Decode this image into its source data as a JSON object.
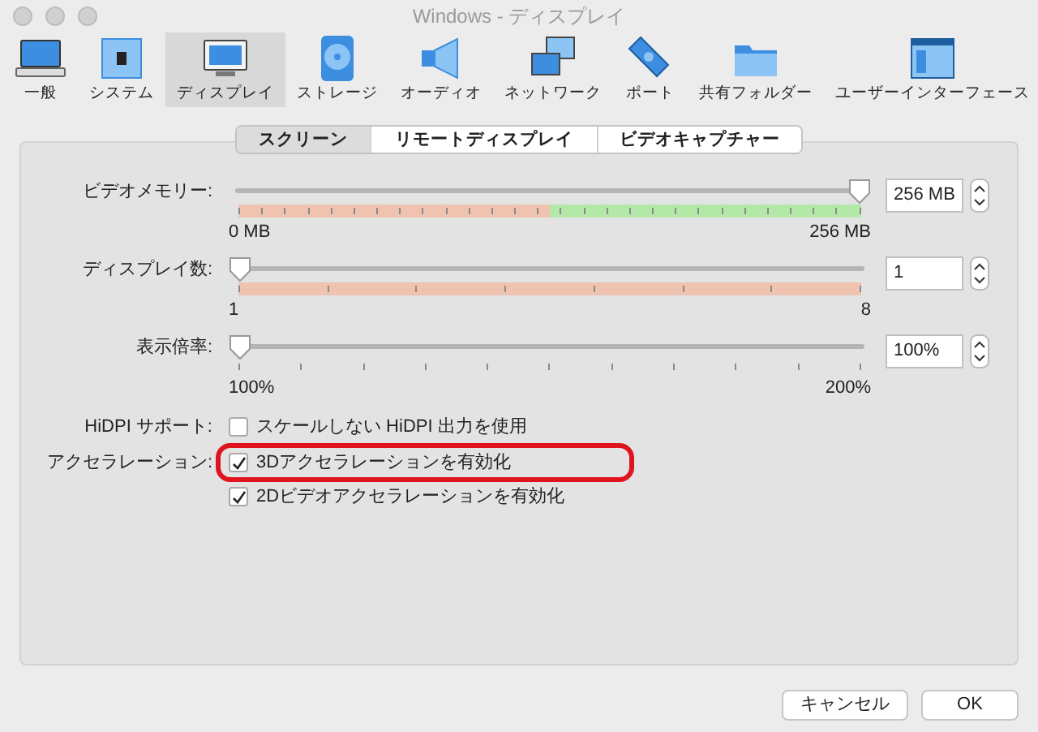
{
  "window": {
    "title": "Windows - ディスプレイ"
  },
  "toolbar": [
    {
      "label": "一般",
      "kind": "general",
      "selected": false
    },
    {
      "label": "システム",
      "kind": "system",
      "selected": false
    },
    {
      "label": "ディスプレイ",
      "kind": "display",
      "selected": true
    },
    {
      "label": "ストレージ",
      "kind": "storage",
      "selected": false
    },
    {
      "label": "オーディオ",
      "kind": "audio",
      "selected": false
    },
    {
      "label": "ネットワーク",
      "kind": "network",
      "selected": false
    },
    {
      "label": "ポート",
      "kind": "ports",
      "selected": false
    },
    {
      "label": "共有フォルダー",
      "kind": "folder",
      "selected": false
    },
    {
      "label": "ユーザーインターフェース",
      "kind": "ui",
      "selected": false
    }
  ],
  "tabs": [
    {
      "label": "スクリーン",
      "selected": true
    },
    {
      "label": "リモートディスプレイ",
      "selected": false
    },
    {
      "label": "ビデオキャプチャー",
      "selected": false
    }
  ],
  "sliders": [
    {
      "label": "ビデオメモリー:",
      "kind": "memory",
      "level": 1,
      "value": "256 MB",
      "min": "0 MB",
      "max": "256 MB",
      "scale": {
        "kind": "warning",
        "recommended": {
          "level": 0.5
        }
      }
    },
    {
      "label": "ディスプレイ数:",
      "kind": "count",
      "level": 0,
      "value": "1",
      "min": "1",
      "max": "8",
      "scale": {
        "kind": "warning"
      }
    },
    {
      "label": "表示倍率:",
      "kind": "scale",
      "level": 0,
      "value": "100%",
      "min": "100%",
      "max": "200%"
    }
  ],
  "options": [
    {
      "label": "HiDPI サポート:",
      "checkboxes": [
        {
          "text": "スケールしない HiDPI 出力を使用",
          "checked": false,
          "highlighted": false
        }
      ]
    },
    {
      "label": "アクセラレーション:",
      "checkboxes": [
        {
          "text": "3Dアクセラレーションを有効化",
          "checked": true,
          "highlighted": true
        },
        {
          "text": "2Dビデオアクセラレーションを有効化",
          "checked": true,
          "highlighted": false
        }
      ]
    }
  ],
  "buttons": [
    {
      "label": "キャンセル",
      "kind": "cancel"
    },
    {
      "label": "OK",
      "kind": "ok"
    }
  ]
}
